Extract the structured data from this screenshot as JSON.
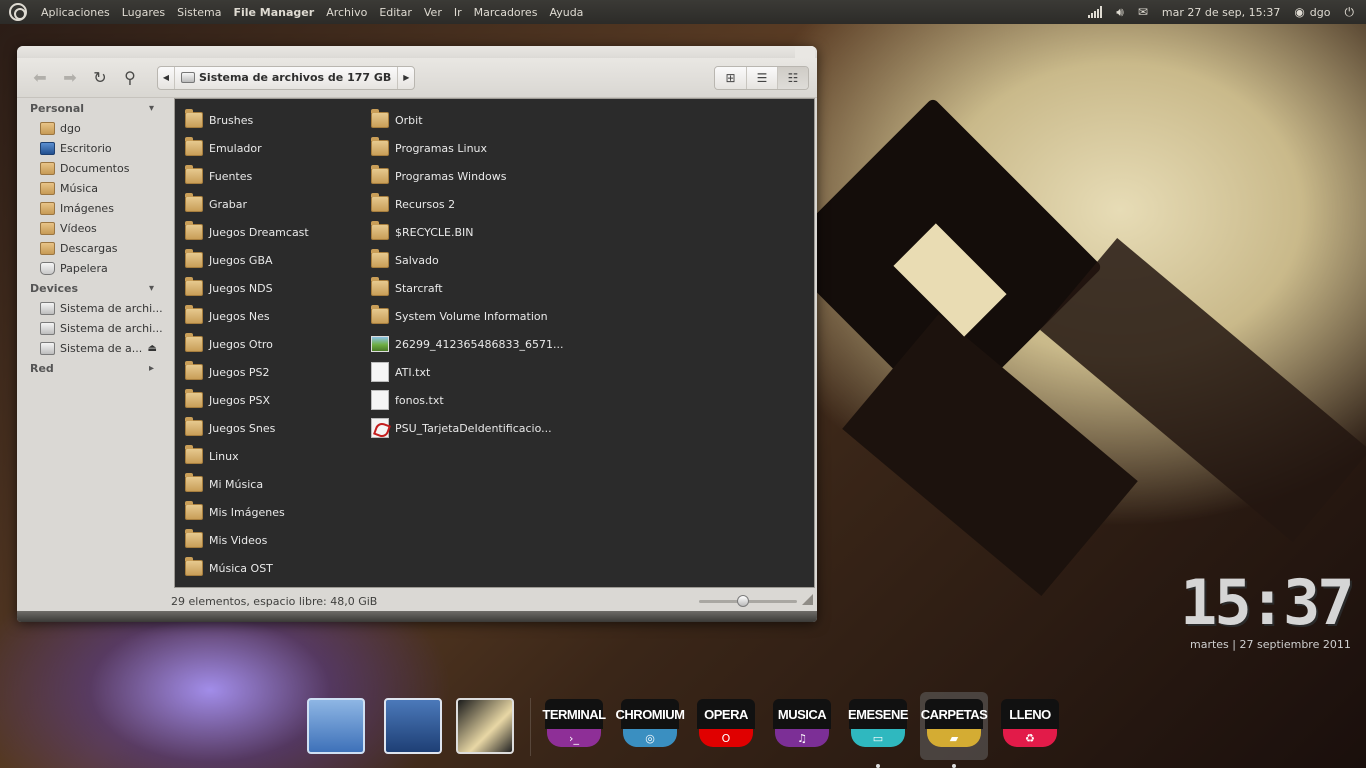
{
  "top_panel": {
    "menus": [
      "Aplicaciones",
      "Lugares",
      "Sistema",
      "File Manager",
      "Archivo",
      "Editar",
      "Ver",
      "Ir",
      "Marcadores",
      "Ayuda"
    ],
    "datetime": "mar 27 de sep, 15:37",
    "user": "dgo"
  },
  "window": {
    "location": "Sistema de archivos de 177 GB",
    "sidebar": {
      "personal_header": "Personal",
      "personal_items": [
        "dgo",
        "Escritorio",
        "Documentos",
        "Música",
        "Imágenes",
        "Vídeos",
        "Descargas",
        "Papelera"
      ],
      "devices_header": "Devices",
      "device_items": [
        "Sistema de archi...",
        "Sistema de archi...",
        "Sistema de a..."
      ],
      "network_header": "Red"
    },
    "files_col1": [
      "Brushes",
      "Emulador",
      "Fuentes",
      "Grabar",
      "Juegos Dreamcast",
      "Juegos GBA",
      "Juegos NDS",
      "Juegos Nes",
      "Juegos Otro",
      "Juegos PS2",
      "Juegos PSX",
      "Juegos Snes",
      "Linux",
      "Mi Música",
      "Mis Imágenes",
      "Mis Videos",
      "Música OST"
    ],
    "files_col2": [
      {
        "name": "Orbit",
        "kind": "folder"
      },
      {
        "name": "Programas Linux",
        "kind": "folder"
      },
      {
        "name": "Programas Windows",
        "kind": "folder"
      },
      {
        "name": "Recursos 2",
        "kind": "folder"
      },
      {
        "name": "$RECYCLE.BIN",
        "kind": "folder"
      },
      {
        "name": "Salvado",
        "kind": "folder"
      },
      {
        "name": "Starcraft",
        "kind": "folder"
      },
      {
        "name": "System Volume Information",
        "kind": "folder"
      },
      {
        "name": "26299_412365486833_6571...",
        "kind": "image"
      },
      {
        "name": "ATI.txt",
        "kind": "text"
      },
      {
        "name": "fonos.txt",
        "kind": "text"
      },
      {
        "name": "PSU_TarjetaDeIdentificacio...",
        "kind": "pdf"
      }
    ],
    "status": "29 elementos, espacio libre: 48,0 GiB",
    "zoom_fraction": 0.45
  },
  "desktop": {
    "clock": "15:37",
    "date": "martes | 27 septiembre 2011"
  },
  "dock": {
    "launchers": [
      {
        "label": "TERMINAL",
        "color": "#8e2f97",
        "glyph": "›_"
      },
      {
        "label": "CHROMIUM",
        "color": "#3a8fc1",
        "glyph": "◎"
      },
      {
        "label": "OPERA",
        "color": "#e00000",
        "glyph": "O"
      },
      {
        "label": "MUSICA",
        "color": "#7c2f96",
        "glyph": "♫"
      },
      {
        "label": "EMESENE",
        "color": "#2fb8bf",
        "glyph": "▭"
      },
      {
        "label": "CARPETAS",
        "color": "#d4ac33",
        "glyph": "▰"
      },
      {
        "label": "LLENO",
        "color": "#e21b49",
        "glyph": "♻"
      }
    ]
  }
}
